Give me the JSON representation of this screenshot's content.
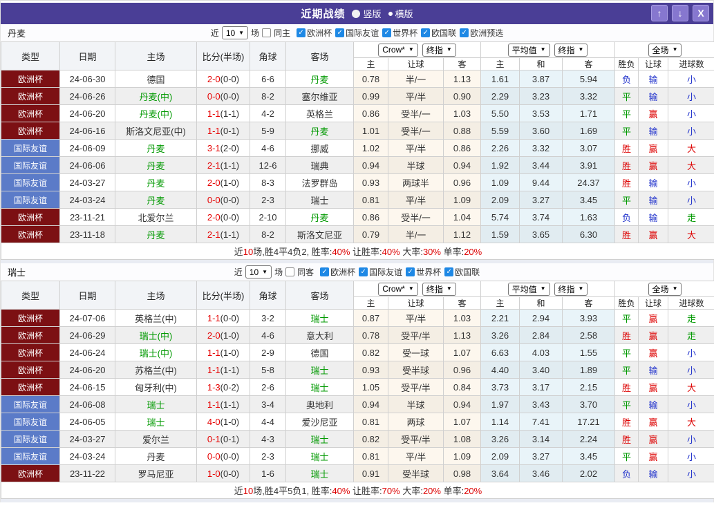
{
  "titlebar": {
    "title": "近期战绩",
    "radio_vertical": "竖版",
    "radio_horizontal": "横版",
    "selected": "横版"
  },
  "window_buttons": {
    "up": "↑",
    "down": "↓",
    "close": "X"
  },
  "columns": {
    "type": "类型",
    "date": "日期",
    "home": "主场",
    "score": "比分(半场)",
    "corner": "角球",
    "away": "客场",
    "odds_home": "主",
    "odds_handicap": "让球",
    "odds_away": "客",
    "avg_home": "主",
    "avg_draw": "和",
    "avg_away": "客",
    "result_wl": "胜负",
    "result_handicap": "让球",
    "result_goals": "进球数"
  },
  "dropdowns": {
    "bookmaker": "Crow*",
    "bookmaker_time": "终指",
    "average": "平均值",
    "average_time": "终指",
    "scope": "全场"
  },
  "colors": {
    "titlebar": "#4a3e96",
    "btn_purple": "#8677cf",
    "euro": "#7c1013",
    "friendly": "#5b7bc8",
    "red": "#dd0000",
    "green": "#009900",
    "blue": "#2233cc",
    "team_green": "#009900",
    "score_red": "#e60000",
    "check_blue": "#1e88e5"
  },
  "sections": [
    {
      "team": "丹麦",
      "filter": {
        "near_label": "近",
        "matches_count": "10",
        "matches_label": "场",
        "same_label": "同主",
        "same_checked": false,
        "competitions": [
          {
            "label": "欧洲杯",
            "checked": true
          },
          {
            "label": "国际友谊",
            "checked": true
          },
          {
            "label": "世界杯",
            "checked": true
          },
          {
            "label": "欧国联",
            "checked": true
          },
          {
            "label": "欧洲预选",
            "checked": true
          }
        ]
      },
      "rows": [
        {
          "type": "欧洲杯",
          "type_style": "euro",
          "date": "24-06-30",
          "home": "德国",
          "home_hl": false,
          "score": "2-0",
          "half": "(0-0)",
          "corner": "6-6",
          "away": "丹麦",
          "away_hl": true,
          "o1": "0.78",
          "hc": "半/一",
          "o2": "1.13",
          "a1": "1.61",
          "a2": "3.87",
          "a3": "5.94",
          "wl": "负",
          "wl_c": "b",
          "h": "输",
          "h_c": "b",
          "g": "小",
          "g_c": "b"
        },
        {
          "type": "欧洲杯",
          "type_style": "euro",
          "date": "24-06-26",
          "home": "丹麦(中)",
          "home_hl": true,
          "score": "0-0",
          "half": "(0-0)",
          "corner": "8-2",
          "away": "塞尔维亚",
          "away_hl": false,
          "o1": "0.99",
          "hc": "平/半",
          "o2": "0.90",
          "a1": "2.29",
          "a2": "3.23",
          "a3": "3.32",
          "wl": "平",
          "wl_c": "g",
          "h": "输",
          "h_c": "b",
          "g": "小",
          "g_c": "b"
        },
        {
          "type": "欧洲杯",
          "type_style": "euro",
          "date": "24-06-20",
          "home": "丹麦(中)",
          "home_hl": true,
          "score": "1-1",
          "half": "(1-1)",
          "corner": "4-2",
          "away": "英格兰",
          "away_hl": false,
          "o1": "0.86",
          "hc": "受半/一",
          "o2": "1.03",
          "a1": "5.50",
          "a2": "3.53",
          "a3": "1.71",
          "wl": "平",
          "wl_c": "g",
          "h": "赢",
          "h_c": "r",
          "g": "小",
          "g_c": "b"
        },
        {
          "type": "欧洲杯",
          "type_style": "euro",
          "date": "24-06-16",
          "home": "斯洛文尼亚(中)",
          "home_hl": false,
          "score": "1-1",
          "half": "(0-1)",
          "corner": "5-9",
          "away": "丹麦",
          "away_hl": true,
          "o1": "1.01",
          "hc": "受半/一",
          "o2": "0.88",
          "a1": "5.59",
          "a2": "3.60",
          "a3": "1.69",
          "wl": "平",
          "wl_c": "g",
          "h": "输",
          "h_c": "b",
          "g": "小",
          "g_c": "b"
        },
        {
          "type": "国际友谊",
          "type_style": "friendly",
          "date": "24-06-09",
          "home": "丹麦",
          "home_hl": true,
          "score": "3-1",
          "half": "(2-0)",
          "corner": "4-6",
          "away": "挪威",
          "away_hl": false,
          "o1": "1.02",
          "hc": "平/半",
          "o2": "0.86",
          "a1": "2.26",
          "a2": "3.32",
          "a3": "3.07",
          "wl": "胜",
          "wl_c": "r",
          "h": "赢",
          "h_c": "r",
          "g": "大",
          "g_c": "r"
        },
        {
          "type": "国际友谊",
          "type_style": "friendly",
          "date": "24-06-06",
          "home": "丹麦",
          "home_hl": true,
          "score": "2-1",
          "half": "(1-1)",
          "corner": "12-6",
          "away": "瑞典",
          "away_hl": false,
          "o1": "0.94",
          "hc": "半球",
          "o2": "0.94",
          "a1": "1.92",
          "a2": "3.44",
          "a3": "3.91",
          "wl": "胜",
          "wl_c": "r",
          "h": "赢",
          "h_c": "r",
          "g": "大",
          "g_c": "r"
        },
        {
          "type": "国际友谊",
          "type_style": "friendly",
          "date": "24-03-27",
          "home": "丹麦",
          "home_hl": true,
          "score": "2-0",
          "half": "(1-0)",
          "corner": "8-3",
          "away": "法罗群岛",
          "away_hl": false,
          "o1": "0.93",
          "hc": "两球半",
          "o2": "0.96",
          "a1": "1.09",
          "a2": "9.44",
          "a3": "24.37",
          "wl": "胜",
          "wl_c": "r",
          "h": "输",
          "h_c": "b",
          "g": "小",
          "g_c": "b"
        },
        {
          "type": "国际友谊",
          "type_style": "friendly",
          "date": "24-03-24",
          "home": "丹麦",
          "home_hl": true,
          "score": "0-0",
          "half": "(0-0)",
          "corner": "2-3",
          "away": "瑞士",
          "away_hl": false,
          "o1": "0.81",
          "hc": "平/半",
          "o2": "1.09",
          "a1": "2.09",
          "a2": "3.27",
          "a3": "3.45",
          "wl": "平",
          "wl_c": "g",
          "h": "输",
          "h_c": "b",
          "g": "小",
          "g_c": "b"
        },
        {
          "type": "欧洲杯",
          "type_style": "euro",
          "date": "23-11-21",
          "home": "北爱尔兰",
          "home_hl": false,
          "score": "2-0",
          "half": "(0-0)",
          "corner": "2-10",
          "away": "丹麦",
          "away_hl": true,
          "o1": "0.86",
          "hc": "受半/一",
          "o2": "1.04",
          "a1": "5.74",
          "a2": "3.74",
          "a3": "1.63",
          "wl": "负",
          "wl_c": "b",
          "h": "输",
          "h_c": "b",
          "g": "走",
          "g_c": "g"
        },
        {
          "type": "欧洲杯",
          "type_style": "euro",
          "date": "23-11-18",
          "home": "丹麦",
          "home_hl": true,
          "score": "2-1",
          "half": "(1-1)",
          "corner": "8-2",
          "away": "斯洛文尼亚",
          "away_hl": false,
          "o1": "0.79",
          "hc": "半/一",
          "o2": "1.12",
          "a1": "1.59",
          "a2": "3.65",
          "a3": "6.30",
          "wl": "胜",
          "wl_c": "r",
          "h": "赢",
          "h_c": "r",
          "g": "大",
          "g_c": "r"
        }
      ],
      "summary_segments": [
        {
          "t": "近",
          "c": "k"
        },
        {
          "t": "10",
          "c": "r"
        },
        {
          "t": "场,胜4平4负2, 胜率:",
          "c": "k"
        },
        {
          "t": "40%",
          "c": "r"
        },
        {
          "t": " 让胜率:",
          "c": "k"
        },
        {
          "t": "40%",
          "c": "r"
        },
        {
          "t": " 大率:",
          "c": "k"
        },
        {
          "t": "30%",
          "c": "r"
        },
        {
          "t": " 单率:",
          "c": "k"
        },
        {
          "t": "20%",
          "c": "r"
        }
      ]
    },
    {
      "team": "瑞士",
      "filter": {
        "near_label": "近",
        "matches_count": "10",
        "matches_label": "场",
        "same_label": "同客",
        "same_checked": false,
        "competitions": [
          {
            "label": "欧洲杯",
            "checked": true
          },
          {
            "label": "国际友谊",
            "checked": true
          },
          {
            "label": "世界杯",
            "checked": true
          },
          {
            "label": "欧国联",
            "checked": true
          }
        ]
      },
      "rows": [
        {
          "type": "欧洲杯",
          "type_style": "euro",
          "date": "24-07-06",
          "home": "英格兰(中)",
          "home_hl": false,
          "score": "1-1",
          "half": "(0-0)",
          "corner": "3-2",
          "away": "瑞士",
          "away_hl": true,
          "o1": "0.87",
          "hc": "平/半",
          "o2": "1.03",
          "a1": "2.21",
          "a2": "2.94",
          "a3": "3.93",
          "wl": "平",
          "wl_c": "g",
          "h": "赢",
          "h_c": "r",
          "g": "走",
          "g_c": "g"
        },
        {
          "type": "欧洲杯",
          "type_style": "euro",
          "date": "24-06-29",
          "home": "瑞士(中)",
          "home_hl": true,
          "score": "2-0",
          "half": "(1-0)",
          "corner": "4-6",
          "away": "意大利",
          "away_hl": false,
          "o1": "0.78",
          "hc": "受平/半",
          "o2": "1.13",
          "a1": "3.26",
          "a2": "2.84",
          "a3": "2.58",
          "wl": "胜",
          "wl_c": "r",
          "h": "赢",
          "h_c": "r",
          "g": "走",
          "g_c": "g"
        },
        {
          "type": "欧洲杯",
          "type_style": "euro",
          "date": "24-06-24",
          "home": "瑞士(中)",
          "home_hl": true,
          "score": "1-1",
          "half": "(1-0)",
          "corner": "2-9",
          "away": "德国",
          "away_hl": false,
          "o1": "0.82",
          "hc": "受一球",
          "o2": "1.07",
          "a1": "6.63",
          "a2": "4.03",
          "a3": "1.55",
          "wl": "平",
          "wl_c": "g",
          "h": "赢",
          "h_c": "r",
          "g": "小",
          "g_c": "b"
        },
        {
          "type": "欧洲杯",
          "type_style": "euro",
          "date": "24-06-20",
          "home": "苏格兰(中)",
          "home_hl": false,
          "score": "1-1",
          "half": "(1-1)",
          "corner": "5-8",
          "away": "瑞士",
          "away_hl": true,
          "o1": "0.93",
          "hc": "受半球",
          "o2": "0.96",
          "a1": "4.40",
          "a2": "3.40",
          "a3": "1.89",
          "wl": "平",
          "wl_c": "g",
          "h": "输",
          "h_c": "b",
          "g": "小",
          "g_c": "b"
        },
        {
          "type": "欧洲杯",
          "type_style": "euro",
          "date": "24-06-15",
          "home": "匈牙利(中)",
          "home_hl": false,
          "score": "1-3",
          "half": "(0-2)",
          "corner": "2-6",
          "away": "瑞士",
          "away_hl": true,
          "o1": "1.05",
          "hc": "受平/半",
          "o2": "0.84",
          "a1": "3.73",
          "a2": "3.17",
          "a3": "2.15",
          "wl": "胜",
          "wl_c": "r",
          "h": "赢",
          "h_c": "r",
          "g": "大",
          "g_c": "r"
        },
        {
          "type": "国际友谊",
          "type_style": "friendly",
          "date": "24-06-08",
          "home": "瑞士",
          "home_hl": true,
          "score": "1-1",
          "half": "(1-1)",
          "corner": "3-4",
          "away": "奥地利",
          "away_hl": false,
          "o1": "0.94",
          "hc": "半球",
          "o2": "0.94",
          "a1": "1.97",
          "a2": "3.43",
          "a3": "3.70",
          "wl": "平",
          "wl_c": "g",
          "h": "输",
          "h_c": "b",
          "g": "小",
          "g_c": "b"
        },
        {
          "type": "国际友谊",
          "type_style": "friendly",
          "date": "24-06-05",
          "home": "瑞士",
          "home_hl": true,
          "score": "4-0",
          "half": "(1-0)",
          "corner": "4-4",
          "away": "爱沙尼亚",
          "away_hl": false,
          "o1": "0.81",
          "hc": "两球",
          "o2": "1.07",
          "a1": "1.14",
          "a2": "7.41",
          "a3": "17.21",
          "wl": "胜",
          "wl_c": "r",
          "h": "赢",
          "h_c": "r",
          "g": "大",
          "g_c": "r"
        },
        {
          "type": "国际友谊",
          "type_style": "friendly",
          "date": "24-03-27",
          "home": "爱尔兰",
          "home_hl": false,
          "score": "0-1",
          "half": "(0-1)",
          "corner": "4-3",
          "away": "瑞士",
          "away_hl": true,
          "o1": "0.82",
          "hc": "受平/半",
          "o2": "1.08",
          "a1": "3.26",
          "a2": "3.14",
          "a3": "2.24",
          "wl": "胜",
          "wl_c": "r",
          "h": "赢",
          "h_c": "r",
          "g": "小",
          "g_c": "b"
        },
        {
          "type": "国际友谊",
          "type_style": "friendly",
          "date": "24-03-24",
          "home": "丹麦",
          "home_hl": false,
          "score": "0-0",
          "half": "(0-0)",
          "corner": "2-3",
          "away": "瑞士",
          "away_hl": true,
          "o1": "0.81",
          "hc": "平/半",
          "o2": "1.09",
          "a1": "2.09",
          "a2": "3.27",
          "a3": "3.45",
          "wl": "平",
          "wl_c": "g",
          "h": "赢",
          "h_c": "r",
          "g": "小",
          "g_c": "b"
        },
        {
          "type": "欧洲杯",
          "type_style": "euro",
          "date": "23-11-22",
          "home": "罗马尼亚",
          "home_hl": false,
          "score": "1-0",
          "half": "(0-0)",
          "corner": "1-6",
          "away": "瑞士",
          "away_hl": true,
          "o1": "0.91",
          "hc": "受半球",
          "o2": "0.98",
          "a1": "3.64",
          "a2": "3.46",
          "a3": "2.02",
          "wl": "负",
          "wl_c": "b",
          "h": "输",
          "h_c": "b",
          "g": "小",
          "g_c": "b"
        }
      ],
      "summary_segments": [
        {
          "t": "近",
          "c": "k"
        },
        {
          "t": "10",
          "c": "r"
        },
        {
          "t": "场,胜4平5负1, 胜率:",
          "c": "k"
        },
        {
          "t": "40%",
          "c": "r"
        },
        {
          "t": " 让胜率:",
          "c": "k"
        },
        {
          "t": "70%",
          "c": "r"
        },
        {
          "t": " 大率:",
          "c": "k"
        },
        {
          "t": "20%",
          "c": "r"
        },
        {
          "t": " 单率:",
          "c": "k"
        },
        {
          "t": "20%",
          "c": "r"
        }
      ]
    }
  ]
}
